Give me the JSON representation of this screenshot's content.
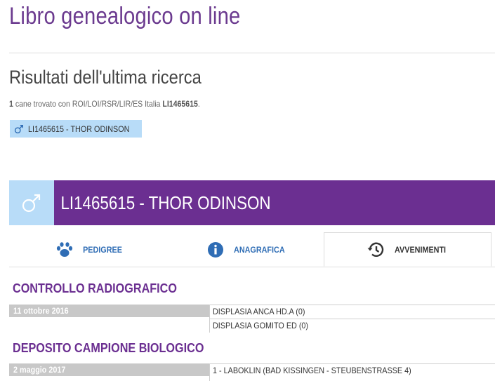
{
  "site": {
    "title": "Libro genealogico on line"
  },
  "search": {
    "heading": "Risultati dell'ultima ricerca",
    "count": "1",
    "text_middle": "cane trovato con ROI/LOI/RSR/LIR/ES Italia",
    "query": "LI1465615",
    "text_end": ".",
    "result_label": "LI1465615 - THOR ODINSON"
  },
  "dog": {
    "title": "LI1465615 - THOR ODINSON",
    "sex_icon": "male-icon"
  },
  "tabs": [
    {
      "label": "PEDIGREE",
      "icon": "paw-icon"
    },
    {
      "label": "ANAGRAFICA",
      "icon": "info-icon"
    },
    {
      "label": "AVVENIMENTI",
      "icon": "history-icon",
      "active": true
    }
  ],
  "events": [
    {
      "title": "CONTROLLO RADIOGRAFICO",
      "date": "11 ottobre 2016",
      "details": [
        "DISPLASIA ANCA HD.A (0)",
        "DISPLASIA GOMITO ED (0)"
      ]
    },
    {
      "title": "DEPOSITO CAMPIONE BIOLOGICO",
      "date": "2 maggio 2017",
      "details": [
        "1 - LABOKLIN (BAD KISSINGEN - STEUBENSTRASSE 4)"
      ]
    }
  ],
  "colors": {
    "brand_purple": "#6b2f91",
    "light_blue": "#b8dcf8",
    "link_blue": "#2f6db5"
  }
}
